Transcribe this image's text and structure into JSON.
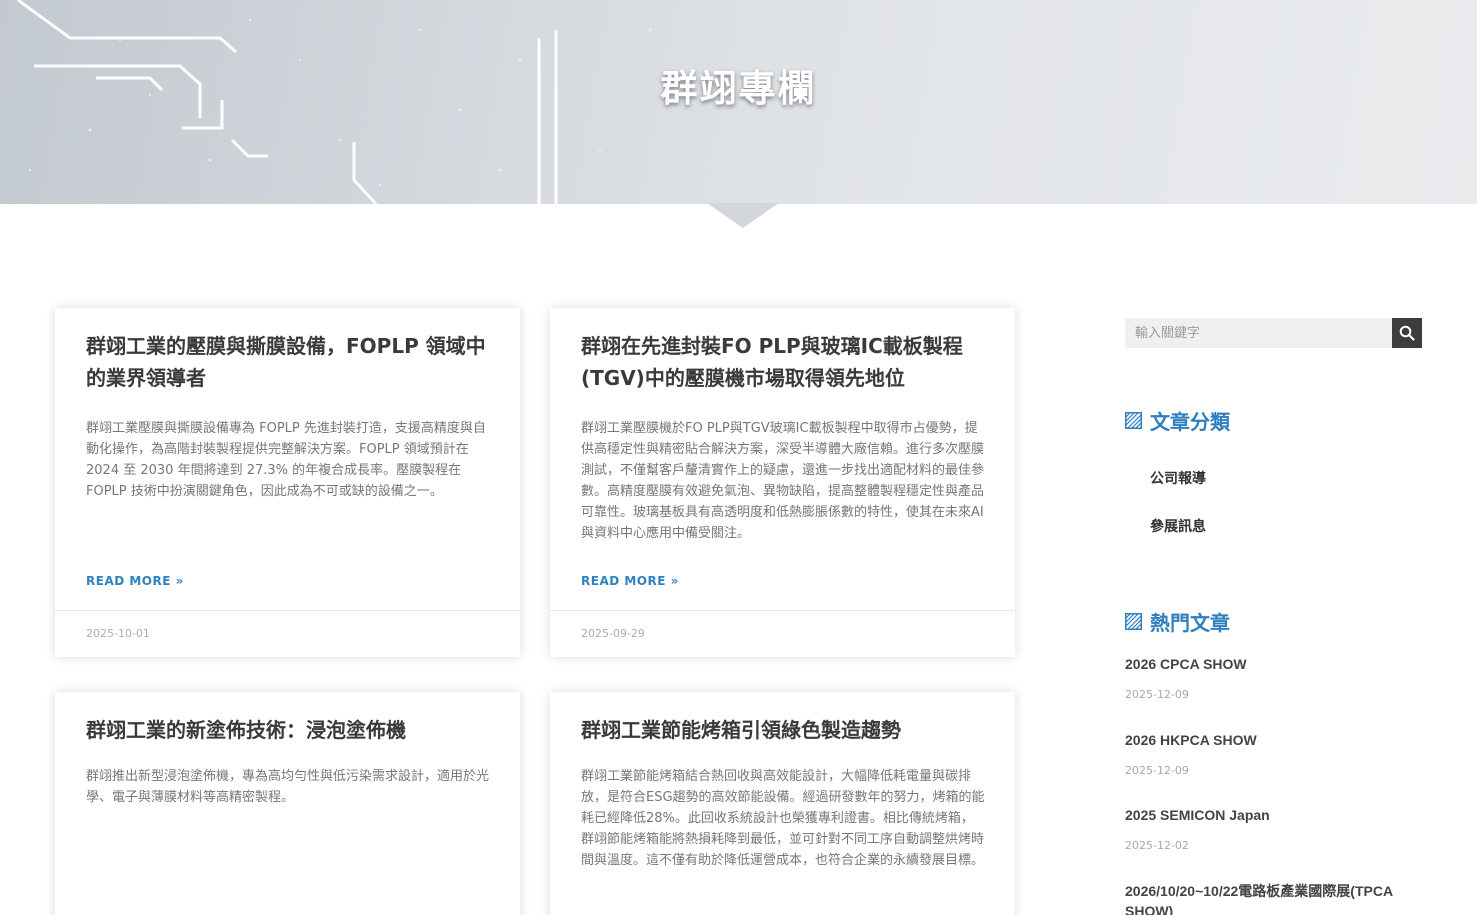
{
  "hero": {
    "title": "群翊專欄"
  },
  "posts": [
    {
      "title": "群翊工業的壓膜與撕膜設備，FOPLP 領域中的業界領導者",
      "excerpt": "群翊工業壓膜與撕膜設備專為 FOPLP 先進封裝打造，支援高精度與自動化操作，為高階封裝製程提供完整解決方案。FOPLP 領域預計在 2024 至 2030 年間將達到 27.3% 的年複合成長率。壓膜製程在 FOPLP 技術中扮演關鍵角色，因此成為不可或缺的設備之一。",
      "read_more": "READ MORE »",
      "date": "2025-10-01"
    },
    {
      "title": "群翊在先進封裝FO PLP與玻璃IC載板製程(TGV)中的壓膜機市場取得領先地位",
      "excerpt": "群翊工業壓膜機於FO PLP與TGV玻璃IC載板製程中取得市占優勢，提供高穩定性與精密貼合解決方案，深受半導體大廠信賴。進行多次壓膜測試，不僅幫客戶釐清實作上的疑慮，還進一步找出適配材料的最佳參數。高精度壓膜有效避免氣泡、異物缺陷，提高整體製程穩定性與產品可靠性。玻璃基板具有高透明度和低熱膨脹係數的特性，使其在未來AI與資料中心應用中備受關注。",
      "read_more": "READ MORE »",
      "date": "2025-09-29"
    },
    {
      "title": "群翊工業的新塗佈技術：浸泡塗佈機",
      "excerpt": "群翊推出新型浸泡塗佈機，專為高均勻性與低污染需求設計，適用於光學、電子與薄膜材料等高精密製程。"
    },
    {
      "title": "群翊工業節能烤箱引領綠色製造趨勢",
      "excerpt": "群翊工業節能烤箱結合熱回收與高效能設計，大幅降低耗電量與碳排放，是符合ESG趨勢的高效節能設備。經過研發數年的努力，烤箱的能耗已經降低28%。此回收系統設計也榮獲專利證書。相比傳統烤箱，群翊節能烤箱能將熱損耗降到最低，並可針對不同工序自動調整烘烤時間與溫度。這不僅有助於降低運營成本，也符合企業的永續發展目標。"
    }
  ],
  "sidebar": {
    "search": {
      "placeholder": "輸入關鍵字"
    },
    "categories": {
      "title": "文章分類",
      "items": [
        "公司報導",
        "參展訊息"
      ]
    },
    "popular": {
      "title": "熱門文章",
      "items": [
        {
          "title": "2026 CPCA SHOW",
          "date": "2025-12-09"
        },
        {
          "title": "2026 HKPCA SHOW",
          "date": "2025-12-09"
        },
        {
          "title": "2025 SEMICON Japan",
          "date": "2025-12-02"
        },
        {
          "title": "2026/10/20~10/22電路板產業國際展(TPCA SHOW)"
        }
      ]
    }
  },
  "colors": {
    "accent": "#2f7fbf",
    "link": "#2f82c0",
    "search_button": "#3d3d3d"
  }
}
